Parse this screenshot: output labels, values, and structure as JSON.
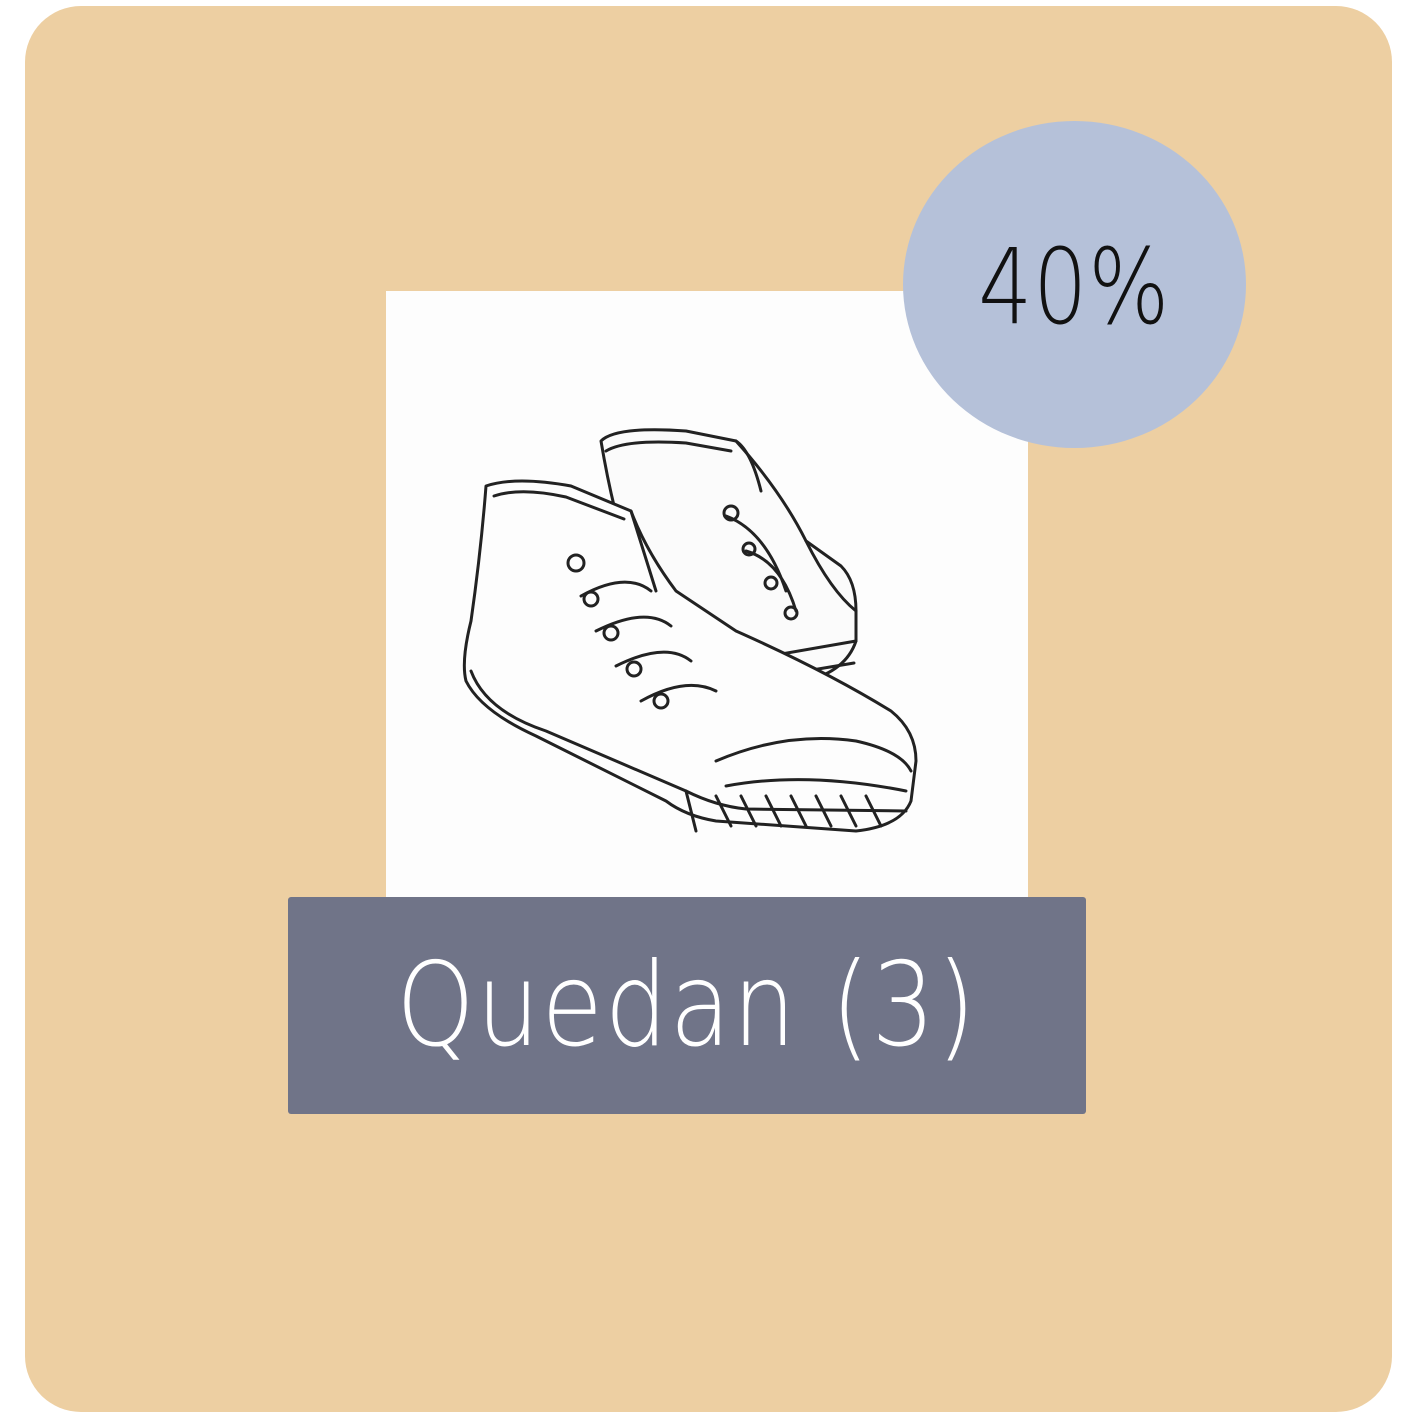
{
  "card": {
    "background_color": "#edcfa2"
  },
  "product_image": {
    "icon": "high-top-sneakers-icon"
  },
  "discount_badge": {
    "text": "40%",
    "color": "#b5c1d9"
  },
  "category_label": {
    "text": "Quedan (3)",
    "color": "#707488"
  }
}
